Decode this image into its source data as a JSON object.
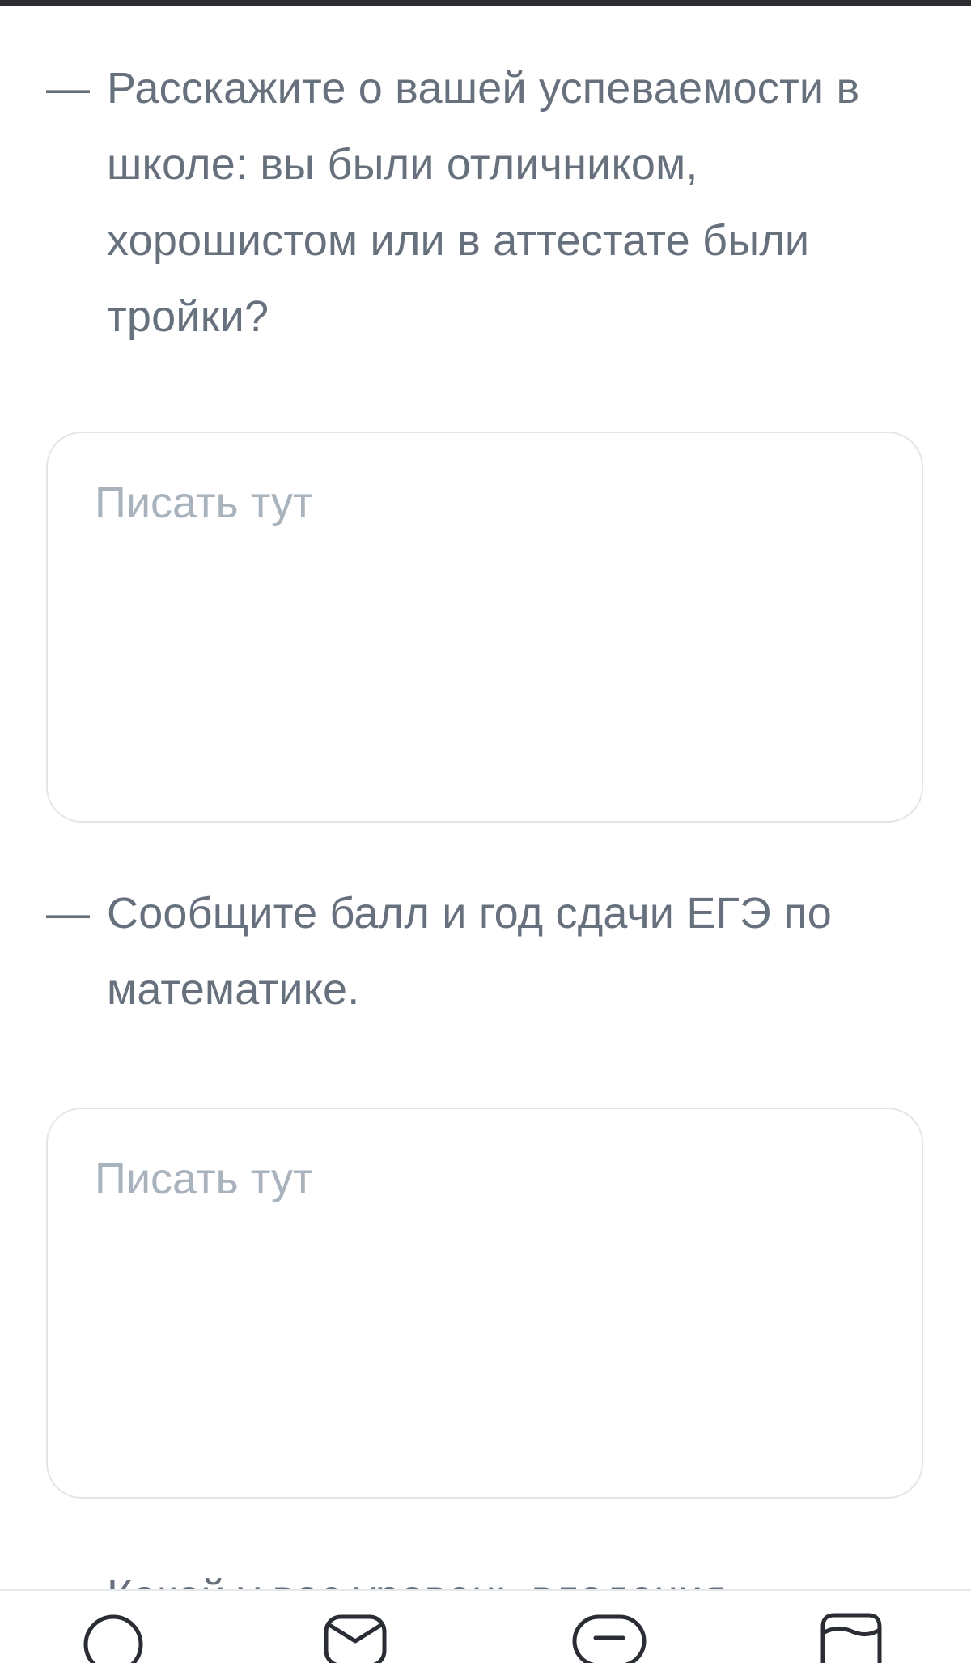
{
  "questions": [
    {
      "dash": "—",
      "text": "Расскажите о вашей успеваемости в школе: вы были отличником, хорошистом или в аттестате были тройки?",
      "placeholder": "Писать тут"
    },
    {
      "dash": "—",
      "text": "Сообщите балл и год сдачи ЕГЭ по математике.",
      "placeholder": "Писать тут"
    },
    {
      "text": "Какой у вас уровень владения"
    }
  ],
  "bottom_nav": {
    "items": [
      {
        "icon": "home-icon"
      },
      {
        "icon": "mail-icon"
      },
      {
        "icon": "chat-icon"
      },
      {
        "icon": "book-icon"
      }
    ]
  }
}
